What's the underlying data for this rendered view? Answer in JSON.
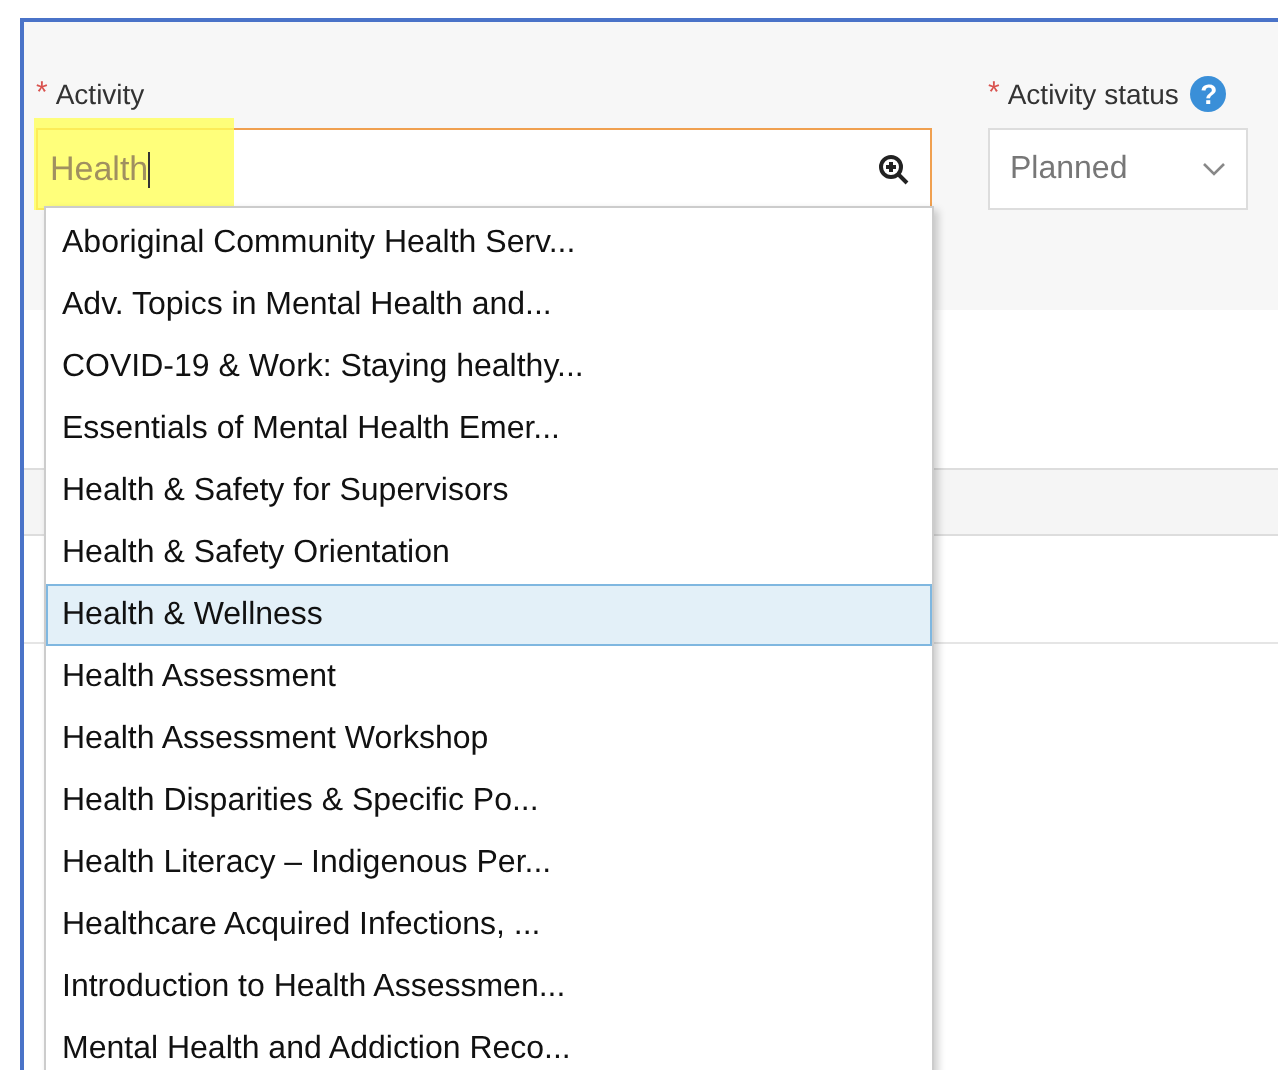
{
  "activity_field": {
    "required_mark": "*",
    "label": "Activity",
    "value": "Health",
    "highlighted": true
  },
  "status_field": {
    "required_mark": "*",
    "label": "Activity status",
    "help": "?",
    "value": "Planned"
  },
  "dropdown": {
    "options": [
      {
        "label": "Aboriginal Community Health Serv...",
        "selected": false
      },
      {
        "label": "Adv. Topics in Mental Health and...",
        "selected": false
      },
      {
        "label": "COVID-19 & Work: Staying healthy...",
        "selected": false
      },
      {
        "label": "Essentials of Mental Health Emer...",
        "selected": false
      },
      {
        "label": "Health & Safety for Supervisors",
        "selected": false
      },
      {
        "label": "Health & Safety Orientation",
        "selected": false
      },
      {
        "label": "Health & Wellness",
        "selected": true
      },
      {
        "label": "Health Assessment",
        "selected": false
      },
      {
        "label": "Health Assessment Workshop",
        "selected": false
      },
      {
        "label": "Health Disparities & Specific Po...",
        "selected": false
      },
      {
        "label": "Health Literacy – Indigenous Per...",
        "selected": false
      },
      {
        "label": "Healthcare Acquired Infections, ...",
        "selected": false
      },
      {
        "label": "Introduction to Health Assessmen...",
        "selected": false
      },
      {
        "label": "Mental Health and Addiction Reco...",
        "selected": false
      }
    ]
  }
}
